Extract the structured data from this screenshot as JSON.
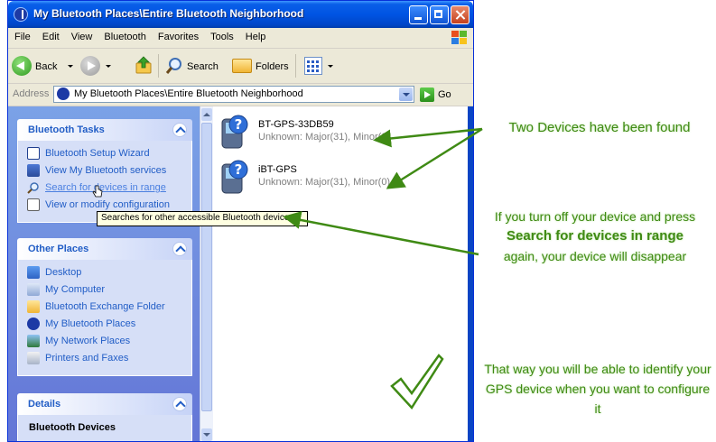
{
  "window": {
    "title": "My Bluetooth Places\\Entire Bluetooth Neighborhood"
  },
  "menu": [
    "File",
    "Edit",
    "View",
    "Bluetooth",
    "Favorites",
    "Tools",
    "Help"
  ],
  "toolbar": {
    "back_label": "Back",
    "search_label": "Search",
    "folders_label": "Folders"
  },
  "address": {
    "label": "Address",
    "value": "My Bluetooth Places\\Entire Bluetooth Neighborhood",
    "go_label": "Go"
  },
  "tasks": {
    "title": "Bluetooth Tasks",
    "items": [
      {
        "label": "Bluetooth Setup Wizard",
        "icon": "wizard-icon"
      },
      {
        "label": "View My Bluetooth services",
        "icon": "services-icon"
      },
      {
        "label": "Search for devices in range",
        "icon": "search-icon"
      },
      {
        "label": "View or modify configuration",
        "icon": "configuration-icon"
      }
    ],
    "tooltip": "Searches for other accessible Bluetooth devices."
  },
  "other_places": {
    "title": "Other Places",
    "items": [
      {
        "label": "Desktop",
        "icon": "desktop-icon"
      },
      {
        "label": "My Computer",
        "icon": "computer-icon"
      },
      {
        "label": "Bluetooth Exchange Folder",
        "icon": "folder-icon"
      },
      {
        "label": "My Bluetooth Places",
        "icon": "bluetooth-icon"
      },
      {
        "label": "My Network Places",
        "icon": "network-icon"
      },
      {
        "label": "Printers and Faxes",
        "icon": "printer-icon"
      }
    ]
  },
  "details": {
    "title": "Details",
    "value": "Bluetooth Devices"
  },
  "devices": [
    {
      "name": "BT-GPS-33DB59",
      "type": "Unknown: Major(31), Minor(0)"
    },
    {
      "name": "iBT-GPS",
      "type": "Unknown: Major(31), Minor(0)"
    }
  ],
  "annotations": {
    "found": "Two Devices have been found",
    "turn_off_1": "If you turn off your device and press",
    "turn_off_2": "Search for devices in range",
    "turn_off_3": "again, your device will disappear",
    "identify": "That way you will be able to identify your GPS device when you want to configure it"
  },
  "colors": {
    "titlebar": "#0054e3",
    "taskpane": "#7ba2e7",
    "link": "#215dc6",
    "annotation": "#3f8a14"
  }
}
